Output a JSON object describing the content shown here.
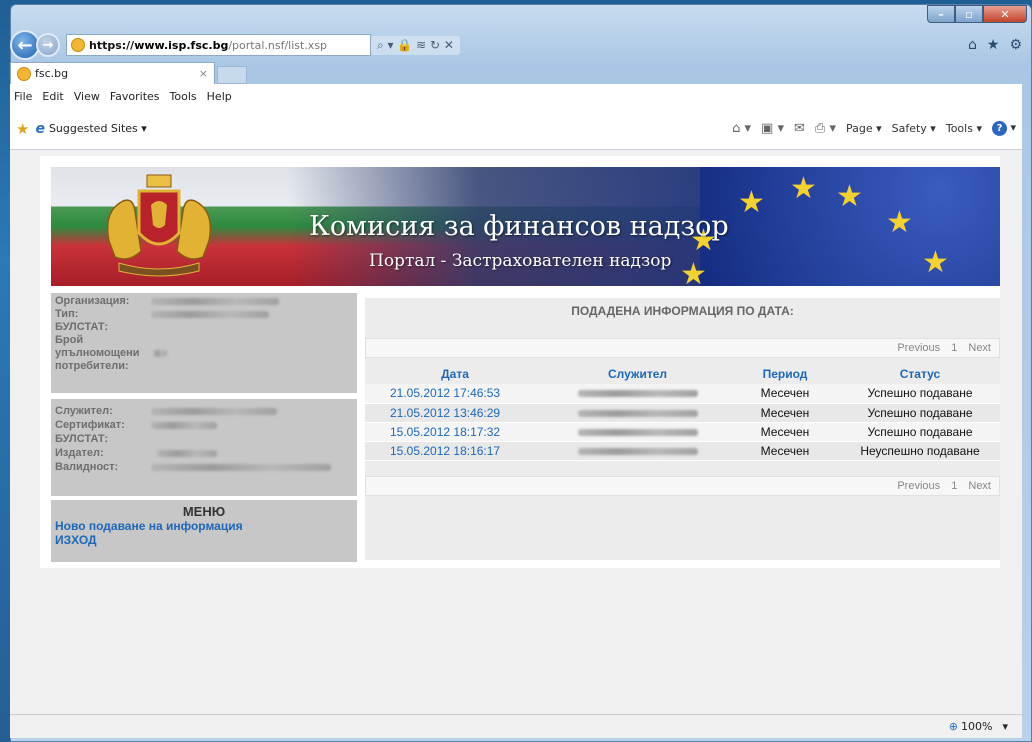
{
  "browser": {
    "url_prefix": "https://",
    "url_domain": "www.isp.fsc.bg",
    "url_path": "/portal.nsf/list.xsp",
    "tab_title": "fsc.bg",
    "tab_close": "×",
    "menu": [
      "File",
      "Edit",
      "View",
      "Favorites",
      "Tools",
      "Help"
    ],
    "favorites_label": "Suggested Sites ▾",
    "commands": [
      "Page ▾",
      "Safety ▾",
      "Tools ▾"
    ],
    "addr_tools": "⌕ ▾ 🔒 ≋ ↻ ✕",
    "zoom": "100%",
    "zoom_arrow": "▾"
  },
  "banner": {
    "title": "Комисия за финансов надзор",
    "subtitle": "Портал - Застрахователен надзор"
  },
  "org_panel": {
    "rows": [
      {
        "label": "Организация:"
      },
      {
        "label": "Тип:"
      },
      {
        "label": "БУЛСТАТ:"
      },
      {
        "label": "Брой"
      },
      {
        "label": "упълномощени"
      },
      {
        "label": "потребители:"
      }
    ]
  },
  "employee_panel": {
    "rows": [
      {
        "label": "Служител:"
      },
      {
        "label": "Сертификат:"
      },
      {
        "label": "БУЛСТАТ:"
      },
      {
        "label": "Издател:"
      },
      {
        "label": "Валидност:"
      }
    ]
  },
  "menu": {
    "title": "МЕНЮ",
    "new_submission": "Ново подаване на информация",
    "logout": "ИЗХОД"
  },
  "main": {
    "heading": "ПОДАДЕНА ИНФОРМАЦИЯ ПО ДАТА:",
    "pager": {
      "previous": "Previous",
      "page": "1",
      "next": "Next"
    },
    "columns": [
      "Дата",
      "Служител",
      "Период",
      "Статус"
    ],
    "rows": [
      {
        "date": "21.05.2012 17:46:53",
        "period": "Месечен",
        "status": "Успешно подаване"
      },
      {
        "date": "21.05.2012 13:46:29",
        "period": "Месечен",
        "status": "Успешно подаване"
      },
      {
        "date": "15.05.2012 18:17:32",
        "period": "Месечен",
        "status": "Успешно подаване"
      },
      {
        "date": "15.05.2012 18:16:17",
        "period": "Месечен",
        "status": "Неуспешно подаване"
      }
    ]
  }
}
